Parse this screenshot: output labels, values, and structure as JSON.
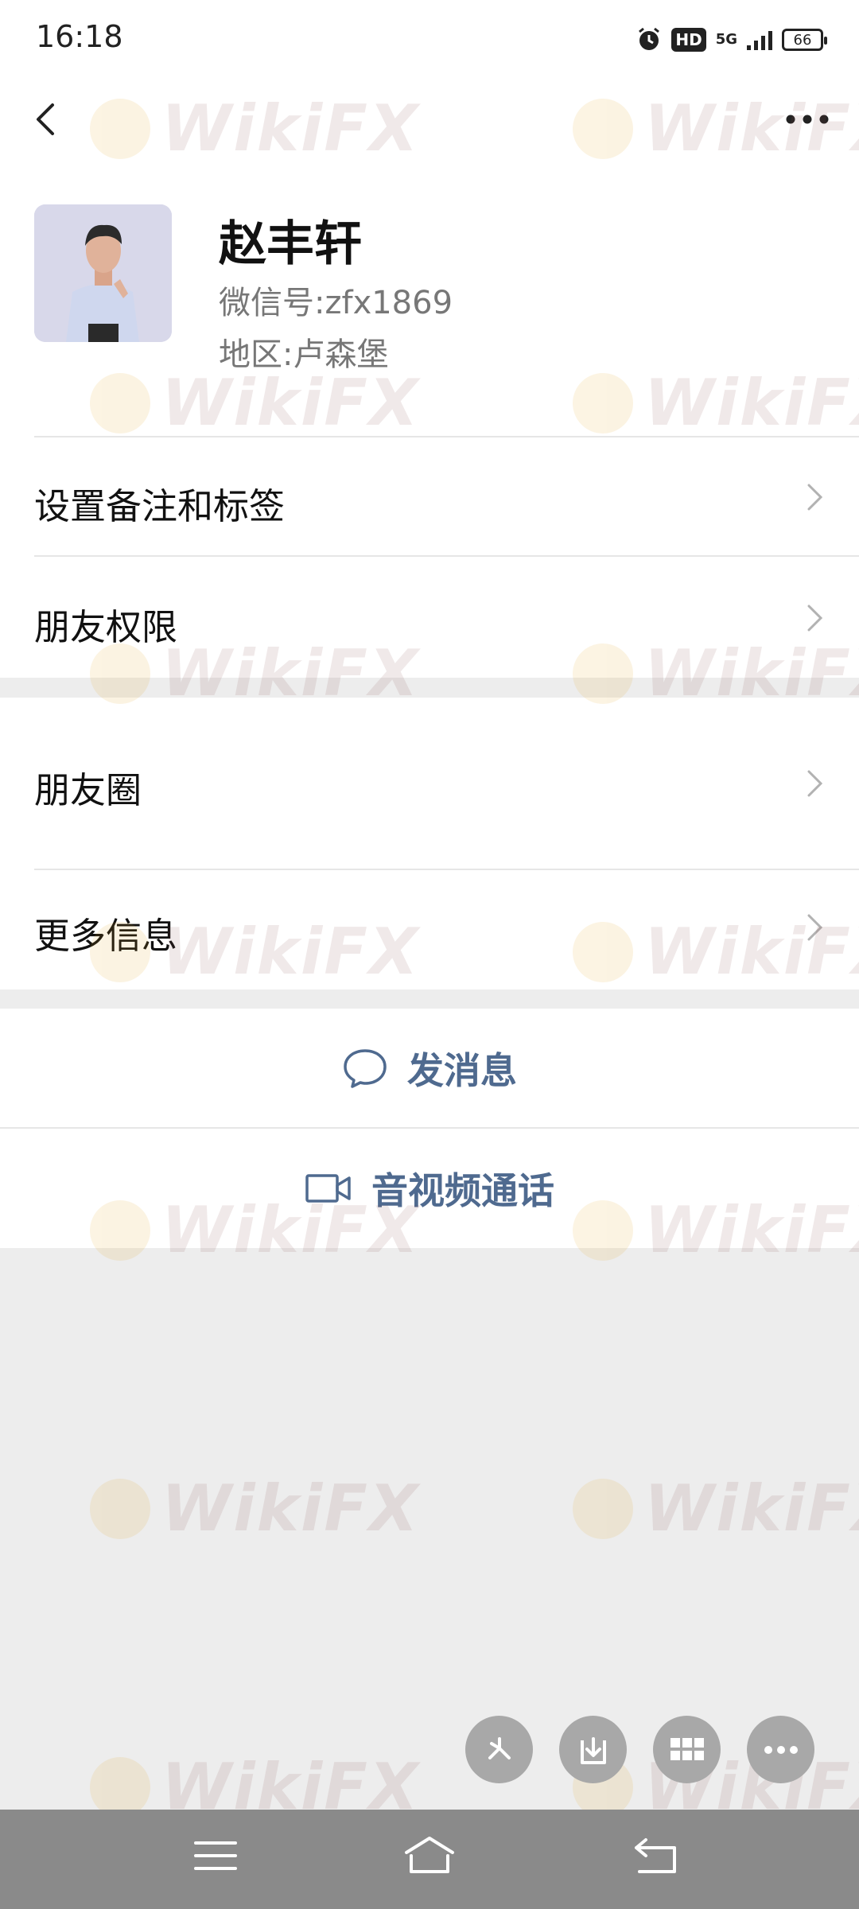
{
  "status_bar": {
    "time": "16:18",
    "network_badge": "HD",
    "network_type": "5G",
    "battery": "66"
  },
  "navbar": {
    "back_icon": "chevron-left-icon",
    "more_icon": "ellipsis-icon"
  },
  "profile": {
    "name": "赵丰轩",
    "wechat_id_label": "微信号:",
    "wechat_id": "zfx1869",
    "region_label": "地区:",
    "region": "卢森堡"
  },
  "menu": {
    "remark_tags": "设置备注和标签",
    "friend_permissions": "朋友权限",
    "moments": "朋友圈",
    "more_info": "更多信息"
  },
  "actions": {
    "send_message": "发消息",
    "av_call": "音视频通话"
  },
  "watermark": "WikiFX",
  "colors": {
    "accent": "#4f6a8f",
    "background": "#ededed",
    "surface": "#ffffff"
  }
}
